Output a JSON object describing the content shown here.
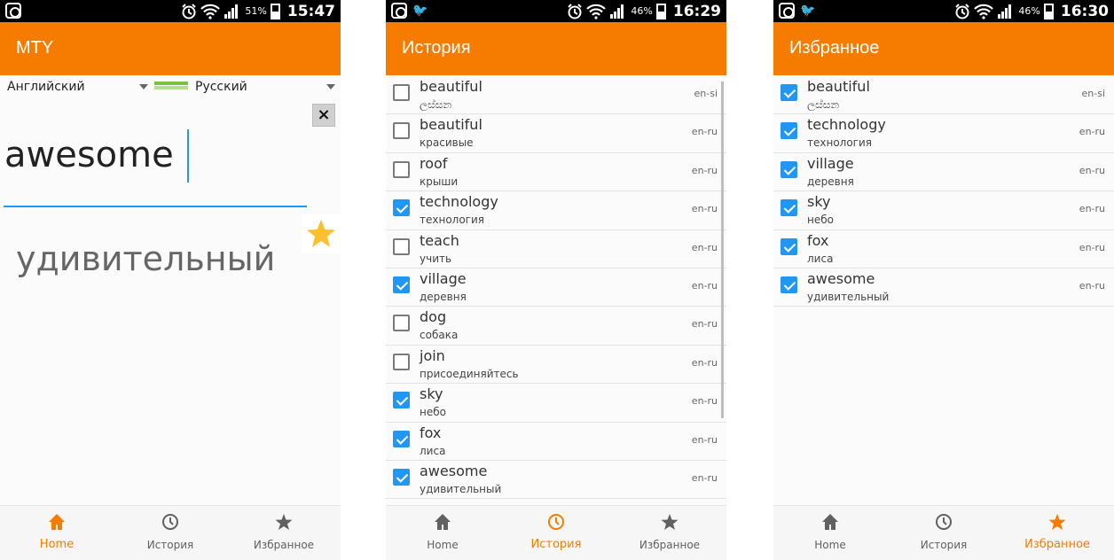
{
  "screens": [
    {
      "status": {
        "battery": "51%",
        "time": "15:47",
        "twitter": false
      },
      "title": "MTY",
      "lang_from": "Английский",
      "lang_to": "Русский",
      "input_text": "awesome",
      "clear_label": "×",
      "result_text": "удивительный",
      "nav": [
        {
          "label": "Home",
          "icon": "home-icon"
        },
        {
          "label": "История",
          "icon": "history-icon"
        },
        {
          "label": "Избранное",
          "icon": "star-icon"
        }
      ],
      "active_nav": 0
    },
    {
      "status": {
        "battery": "46%",
        "time": "16:29",
        "twitter": true
      },
      "title": "История",
      "items": [
        {
          "word": "beautiful",
          "translation": "ලස්සන",
          "pair": "en-si",
          "checked": false
        },
        {
          "word": "beautiful",
          "translation": "красивые",
          "pair": "en-ru",
          "checked": false
        },
        {
          "word": "roof",
          "translation": "крыши",
          "pair": "en-ru",
          "checked": false
        },
        {
          "word": "technology",
          "translation": "технология",
          "pair": "en-ru",
          "checked": true
        },
        {
          "word": "teach",
          "translation": "учить",
          "pair": "en-ru",
          "checked": false
        },
        {
          "word": "village",
          "translation": "деревня",
          "pair": "en-ru",
          "checked": true
        },
        {
          "word": "dog",
          "translation": "собака",
          "pair": "en-ru",
          "checked": false
        },
        {
          "word": "join",
          "translation": "присоединяйтесь",
          "pair": "en-ru",
          "checked": false
        },
        {
          "word": "sky",
          "translation": "небо",
          "pair": "en-ru",
          "checked": true
        },
        {
          "word": "fox",
          "translation": "лиса",
          "pair": "en-ru",
          "checked": true
        },
        {
          "word": "awesome",
          "translation": "удивительный",
          "pair": "en-ru",
          "checked": true
        }
      ],
      "nav": [
        {
          "label": "Home",
          "icon": "home-icon"
        },
        {
          "label": "История",
          "icon": "history-icon"
        },
        {
          "label": "Избранное",
          "icon": "star-icon"
        }
      ],
      "active_nav": 1
    },
    {
      "status": {
        "battery": "46%",
        "time": "16:30",
        "twitter": true
      },
      "title": "Избранное",
      "items": [
        {
          "word": "beautiful",
          "translation": "ලස්සන",
          "pair": "en-si",
          "checked": true
        },
        {
          "word": "technology",
          "translation": "технология",
          "pair": "en-ru",
          "checked": true
        },
        {
          "word": "village",
          "translation": "деревня",
          "pair": "en-ru",
          "checked": true
        },
        {
          "word": "sky",
          "translation": "небо",
          "pair": "en-ru",
          "checked": true
        },
        {
          "word": "fox",
          "translation": "лиса",
          "pair": "en-ru",
          "checked": true
        },
        {
          "word": "awesome",
          "translation": "удивительный",
          "pair": "en-ru",
          "checked": true
        }
      ],
      "nav": [
        {
          "label": "Home",
          "icon": "home-icon"
        },
        {
          "label": "История",
          "icon": "history-icon"
        },
        {
          "label": "Избранное",
          "icon": "star-icon"
        }
      ],
      "active_nav": 2
    }
  ],
  "colors": {
    "accent": "#f57c00",
    "check": "#2196f3",
    "star": "#fbc02d",
    "nav_inactive": "#616161"
  }
}
